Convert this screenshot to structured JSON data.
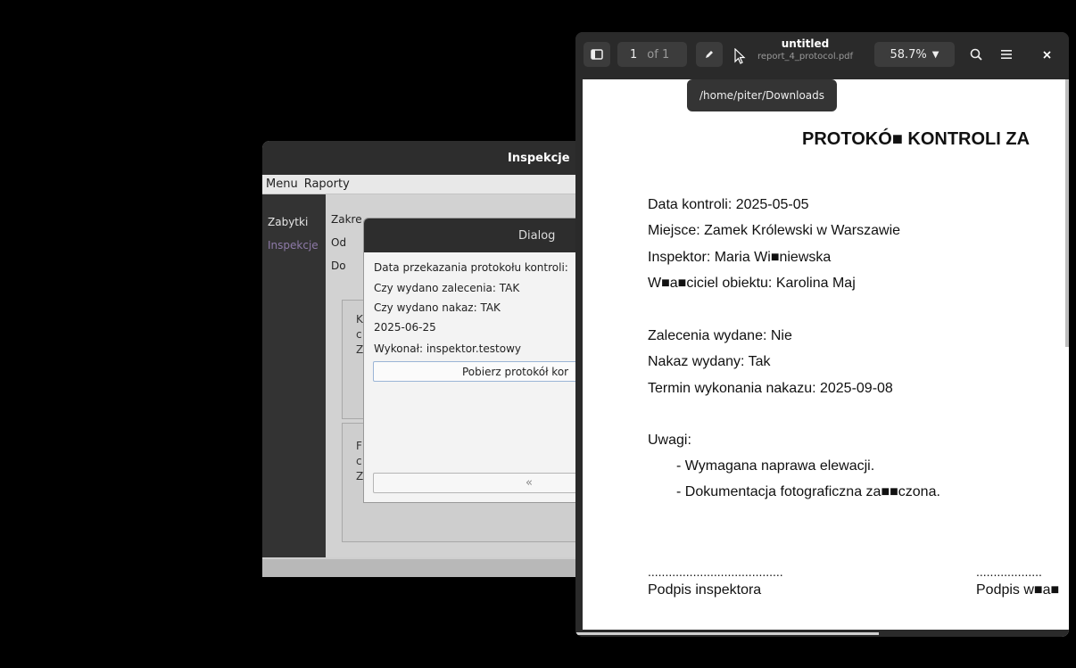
{
  "app_window": {
    "title": "Inspekcje",
    "menu": [
      "Menu",
      "Raporty"
    ],
    "sidebar": [
      {
        "label": "Zabytki",
        "active": false
      },
      {
        "label": "Inspekcje",
        "active": true
      }
    ],
    "form_labels": [
      "Zakre",
      "Od",
      "Do"
    ],
    "card1_letters": [
      "K",
      "c",
      "Z"
    ],
    "card2_letters": [
      "F",
      "c",
      "Z"
    ]
  },
  "dialog": {
    "title": "Dialog",
    "lines": [
      "Data przekazania protokołu kontroli:",
      "Czy wydano zalecenia: TAK",
      "Czy wydano nakaz: TAK",
      "2025-06-25",
      "Wykonał: inspektor.testowy"
    ],
    "download_button": "Pobierz protokół kor",
    "back_button_icon": "back-arrow-icon"
  },
  "pdf_viewer": {
    "page_current": "1",
    "page_total": "of 1",
    "title": "untitled",
    "filename": "report_4_protocol.pdf",
    "zoom": "58.7%",
    "tooltip": "/home/piter/Downloads",
    "icons": [
      "sidebar-toggle-icon",
      "pen-icon",
      "search-icon",
      "menu-icon",
      "close-icon"
    ],
    "document": {
      "heading": "PROTOKÓ■ KONTROLI ZA",
      "info_lines": [
        "Data kontroli: 2025-05-05",
        "Miejsce: Zamek Królewski w Warszawie",
        "Inspektor: Maria Wi■niewska",
        "W■a■ciciel obiektu: Karolina Maj"
      ],
      "result_lines": [
        "Zalecenia wydane: Nie",
        "Nakaz wydany: Tak",
        "Termin wykonania nakazu: 2025-09-08"
      ],
      "notes_label": "Uwagi:",
      "notes": [
        "- Wymagana naprawa elewacji.",
        "- Dokumentacja fotograficzna za■■czona."
      ],
      "sig_dots_left": ".......................................",
      "sig_dots_right": "...................",
      "sig_left": "Podpis inspektora",
      "sig_right": "Podpis w■a■"
    }
  }
}
